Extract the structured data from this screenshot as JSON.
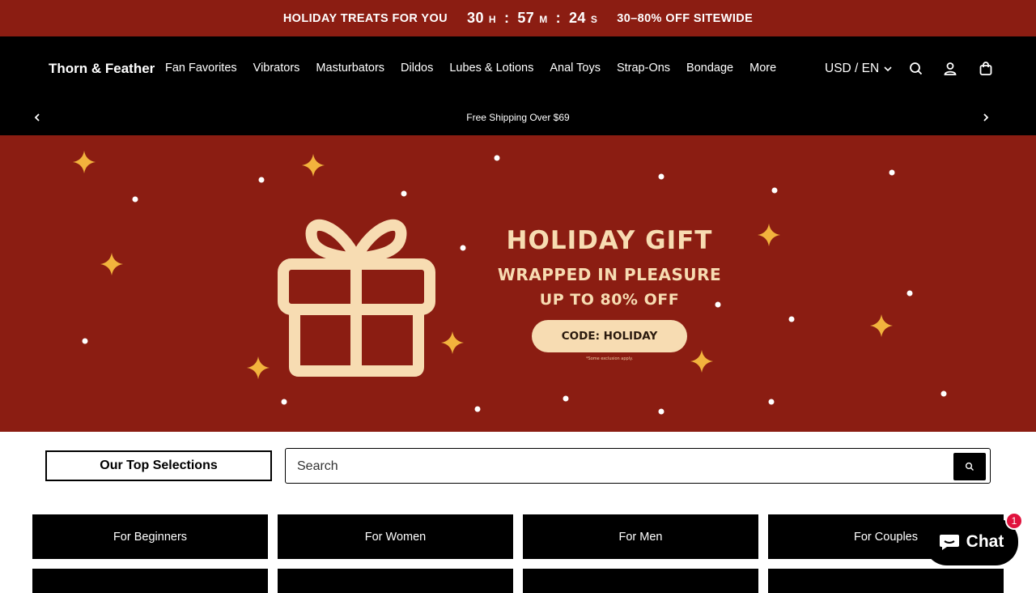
{
  "promo": {
    "left_text": "HOLIDAY TREATS FOR YOU",
    "countdown": [
      {
        "value": "30",
        "unit": "H"
      },
      {
        "value": "57",
        "unit": "M"
      },
      {
        "value": "24",
        "unit": "S"
      }
    ],
    "separator": ":",
    "right_text": "30–80% OFF SITEWIDE"
  },
  "header": {
    "brand": "Thorn & Feather",
    "nav": [
      "Fan Favorites",
      "Vibrators",
      "Masturbators",
      "Dildos",
      "Lubes & Lotions",
      "Anal Toys",
      "Strap-Ons",
      "Bondage",
      "More"
    ],
    "locale": "USD / EN",
    "icons": [
      "search-icon",
      "account-icon",
      "cart-icon"
    ]
  },
  "announcement": {
    "text": "Free Shipping Over $69"
  },
  "hero": {
    "line1": "HOLIDAY GIFT",
    "line2": "WRAPPED IN PLEASURE",
    "line3": "UP TO 80% OFF",
    "code": "CODE: HOLIDAY",
    "fine_print": "*Some exclusion apply.",
    "colors": {
      "background": "#8b1d12",
      "cream": "#f7dcb2",
      "star": "#f2b33d"
    }
  },
  "selections": {
    "label": "Our Top Selections"
  },
  "search": {
    "placeholder": "Search"
  },
  "categories": [
    "For Beginners",
    "For Women",
    "For Men",
    "For Couples"
  ],
  "chat": {
    "label": "Chat",
    "badge": "1"
  }
}
